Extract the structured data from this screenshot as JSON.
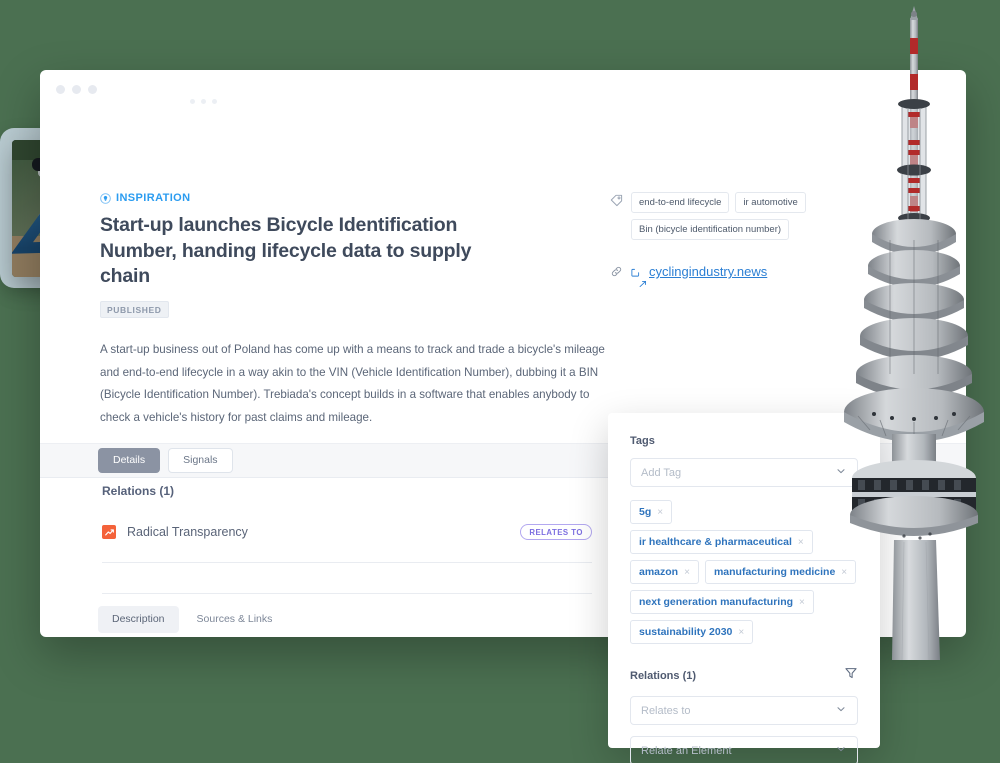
{
  "window": {
    "traffic_dots": 3,
    "menu_dots": 3
  },
  "article": {
    "kicker": "INSPIRATION",
    "kicker_icon": "lightbulb-icon",
    "title": "Start-up launches Bicycle Identification Number, handing lifecycle data to supply chain",
    "status_badge": "PUBLISHED",
    "body": "A start-up business out of Poland has come up with a means to track and trade a bicycle's mileage and end-to-end lifecycle in a way akin to the VIN (Vehicle Identification Number), dubbing it a BIN (Bicycle Identification Number). Trebiada's concept builds in a software that enables anybody to check a vehicle's history for past claims and mileage.",
    "thumbnail_alt": "blue bicycle leaning in a rack"
  },
  "header_tags": {
    "icon": "price-tag-icon",
    "items": [
      "end-to-end lifecycle",
      "ir automotive",
      "Bin (bicycle identification number)"
    ]
  },
  "header_link": {
    "link_icon": "chain-link-icon",
    "external_icon": "external-link-icon",
    "label": "cyclingindustry.news"
  },
  "tabs": {
    "items": [
      {
        "label": "Details",
        "active": true
      },
      {
        "label": "Signals",
        "active": false
      }
    ]
  },
  "relations": {
    "heading": "Relations (1)",
    "rows": [
      {
        "icon": "trending-up-icon",
        "name": "Radical Transparency",
        "relation_type": "RELATES TO"
      }
    ]
  },
  "bottom_tabs": {
    "items": [
      {
        "label": "Description",
        "active": true
      },
      {
        "label": "Sources & Links",
        "active": false
      }
    ]
  },
  "side_panel": {
    "tags_label": "Tags",
    "add_tag_placeholder": "Add Tag",
    "tags": [
      "5g",
      "ir healthcare & pharmaceutical",
      "amazon",
      "manufacturing medicine",
      "next generation manufacturing",
      "sustainability 2030"
    ],
    "remove_glyph": "×",
    "relations_label": "Relations (1)",
    "filter_icon": "funnel-icon",
    "relation_type_placeholder": "Relates to",
    "relate_element_placeholder": "Relate an Element"
  },
  "decor": {
    "tower_alt": "telecommunications tower",
    "background_color": "#4b7051",
    "accent_blue": "#2b7fd4",
    "accent_purple": "#7c6ee0",
    "accent_orange": "#f4623a"
  }
}
